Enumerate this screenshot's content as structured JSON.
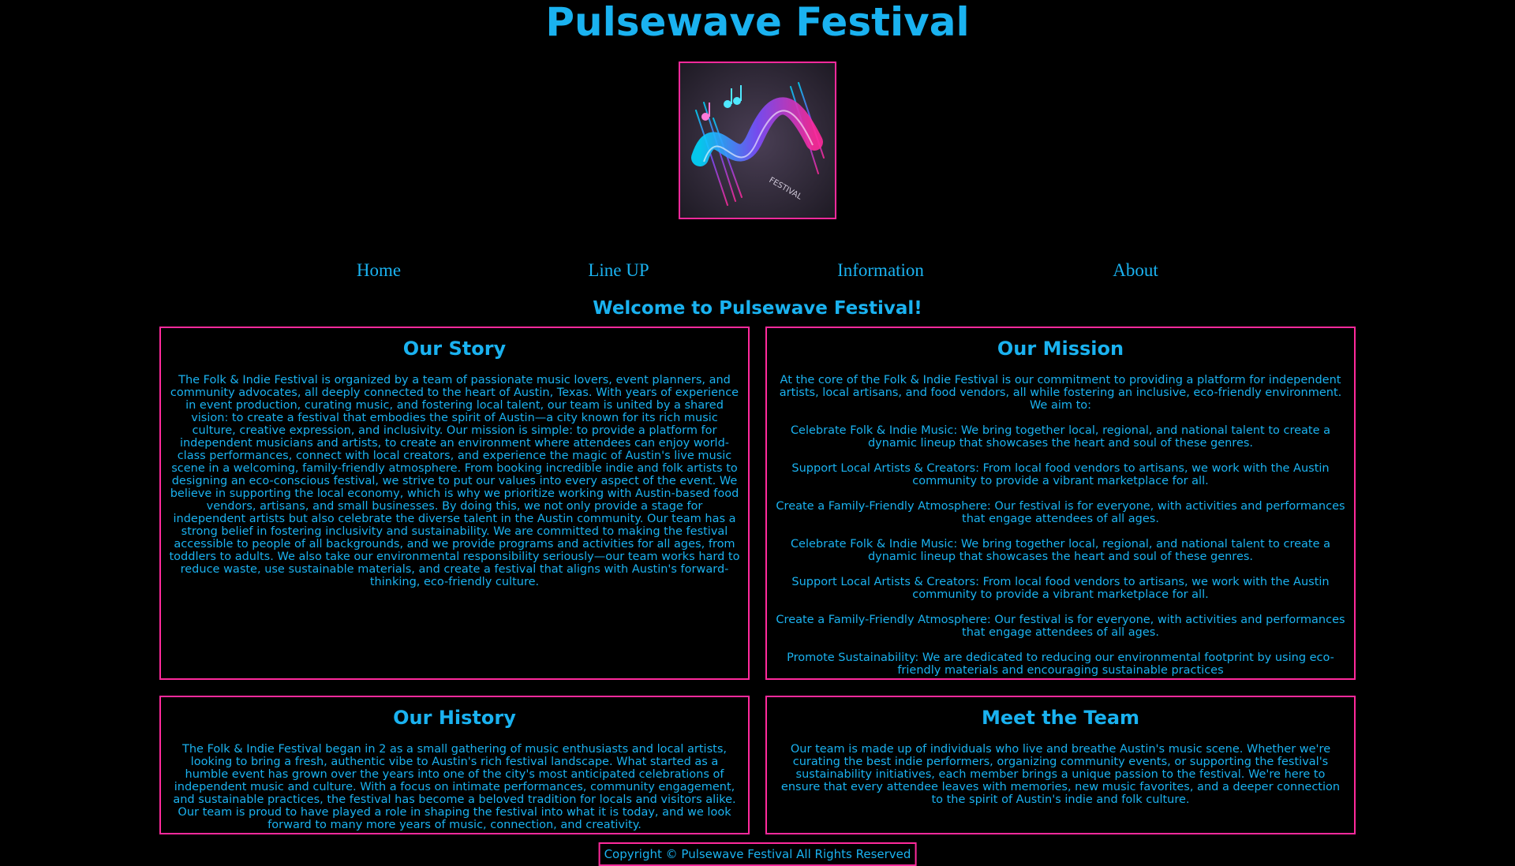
{
  "site": {
    "title": "Pulsewave Festival",
    "logo_icon": "festival-logo-icon",
    "logo_text": "FESTIVAL"
  },
  "nav": {
    "items": [
      {
        "label": "Home"
      },
      {
        "label": "Line UP"
      },
      {
        "label": "Information"
      },
      {
        "label": "About"
      }
    ]
  },
  "welcome": "Welcome to Pulsewave Festival!",
  "sections": {
    "story": {
      "title": "Our Story",
      "body": "The Folk & Indie Festival is organized by a team of passionate music lovers, event planners, and community advocates, all deeply connected to the heart of Austin, Texas. With years of experience in event production, curating music, and fostering local talent, our team is united by a shared vision: to create a festival that embodies the spirit of Austin—a city known for its rich music culture, creative expression, and inclusivity. Our mission is simple: to provide a platform for independent musicians and artists, to create an environment where attendees can enjoy world-class performances, connect with local creators, and experience the magic of Austin's live music scene in a welcoming, family-friendly atmosphere. From booking incredible indie and folk artists to designing an eco-conscious festival, we strive to put our values into every aspect of the event. We believe in supporting the local economy, which is why we prioritize working with Austin-based food vendors, artisans, and small businesses. By doing this, we not only provide a stage for independent artists but also celebrate the diverse talent in the Austin community. Our team has a strong belief in fostering inclusivity and sustainability. We are committed to making the festival accessible to people of all backgrounds, and we provide programs and activities for all ages, from toddlers to adults. We also take our environmental responsibility seriously—our team works hard to reduce waste, use sustainable materials, and create a festival that aligns with Austin's forward-thinking, eco-friendly culture."
    },
    "mission": {
      "title": "Our Mission",
      "intro": "At the core of the Folk & Indie Festival is our commitment to providing a platform for independent artists, local artisans, and food vendors, all while fostering an inclusive, eco-friendly environment. We aim to:",
      "points": [
        "Celebrate Folk & Indie Music: We bring together local, regional, and national talent to create a dynamic lineup that showcases the heart and soul of these genres.",
        "Support Local Artists & Creators: From local food vendors to artisans, we work with the Austin community to provide a vibrant marketplace for all.",
        "Create a Family-Friendly Atmosphere: Our festival is for everyone, with activities and performances that engage attendees of all ages.",
        "Celebrate Folk & Indie Music: We bring together local, regional, and national talent to create a dynamic lineup that showcases the heart and soul of these genres.",
        "Support Local Artists & Creators: From local food vendors to artisans, we work with the Austin community to provide a vibrant marketplace for all.",
        "Create a Family-Friendly Atmosphere: Our festival is for everyone, with activities and performances that engage attendees of all ages.",
        "Promote Sustainability: We are dedicated to reducing our environmental footprint by using eco-friendly materials and encouraging sustainable practices"
      ]
    },
    "history": {
      "title": "Our History",
      "body": "The Folk & Indie Festival began in 2 as a small gathering of music enthusiasts and local artists, looking to bring a fresh, authentic vibe to Austin's rich festival landscape. What started as a humble event has grown over the years into one of the city's most anticipated celebrations of independent music and culture. With a focus on intimate performances, community engagement, and sustainable practices, the festival has become a beloved tradition for locals and visitors alike. Our team is proud to have played a role in shaping the festival into what it is today, and we look forward to many more years of music, connection, and creativity."
    },
    "team": {
      "title": "Meet the Team",
      "body": "Our team is made up of individuals who live and breathe Austin's music scene. Whether we're curating the best indie performers, organizing community events, or supporting the festival's sustainability initiatives, each member brings a unique passion to the festival. We're here to ensure that every attendee leaves with memories, new music favorites, and a deeper connection to the spirit of Austin's indie and folk culture."
    }
  },
  "footer": "Copyright © Pulsewave Festival All Rights Reserved",
  "colors": {
    "text": "#1ab2f0",
    "border": "#ff2a9c",
    "background": "#000000"
  }
}
